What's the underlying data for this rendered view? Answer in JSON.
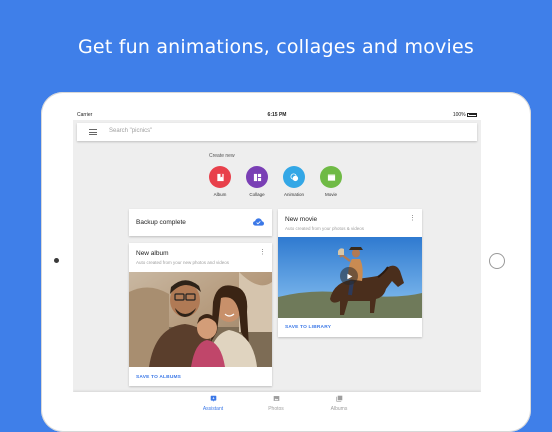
{
  "headline": "Get fun animations, collages and movies",
  "status": {
    "carrier": "Carrier",
    "time": "6:15 PM",
    "battery": "100%"
  },
  "search": {
    "placeholder": "Search \"picnics\""
  },
  "create": {
    "label": "Create new",
    "items": [
      {
        "label": "Album",
        "color": "#e8404b",
        "icon": "album-icon"
      },
      {
        "label": "Collage",
        "color": "#7a3fb5",
        "icon": "collage-icon"
      },
      {
        "label": "Animation",
        "color": "#33a7e6",
        "icon": "animation-icon"
      },
      {
        "label": "Movie",
        "color": "#6fba45",
        "icon": "movie-icon"
      }
    ]
  },
  "backup": {
    "text": "Backup complete",
    "icon": "cloud-done-icon"
  },
  "album_card": {
    "title": "New album",
    "subtitle": "Auto created from your new photos and videos",
    "action": "SAVE TO ALBUMS"
  },
  "movie_card": {
    "title": "New movie",
    "subtitle": "Auto created from your photos & videos",
    "action": "SAVE TO LIBRARY"
  },
  "nav": {
    "items": [
      {
        "label": "Assistant",
        "active": true
      },
      {
        "label": "Photos",
        "active": false
      },
      {
        "label": "Albums",
        "active": false
      }
    ]
  },
  "colors": {
    "background": "#3f7fe9",
    "accent": "#3b78e7"
  }
}
